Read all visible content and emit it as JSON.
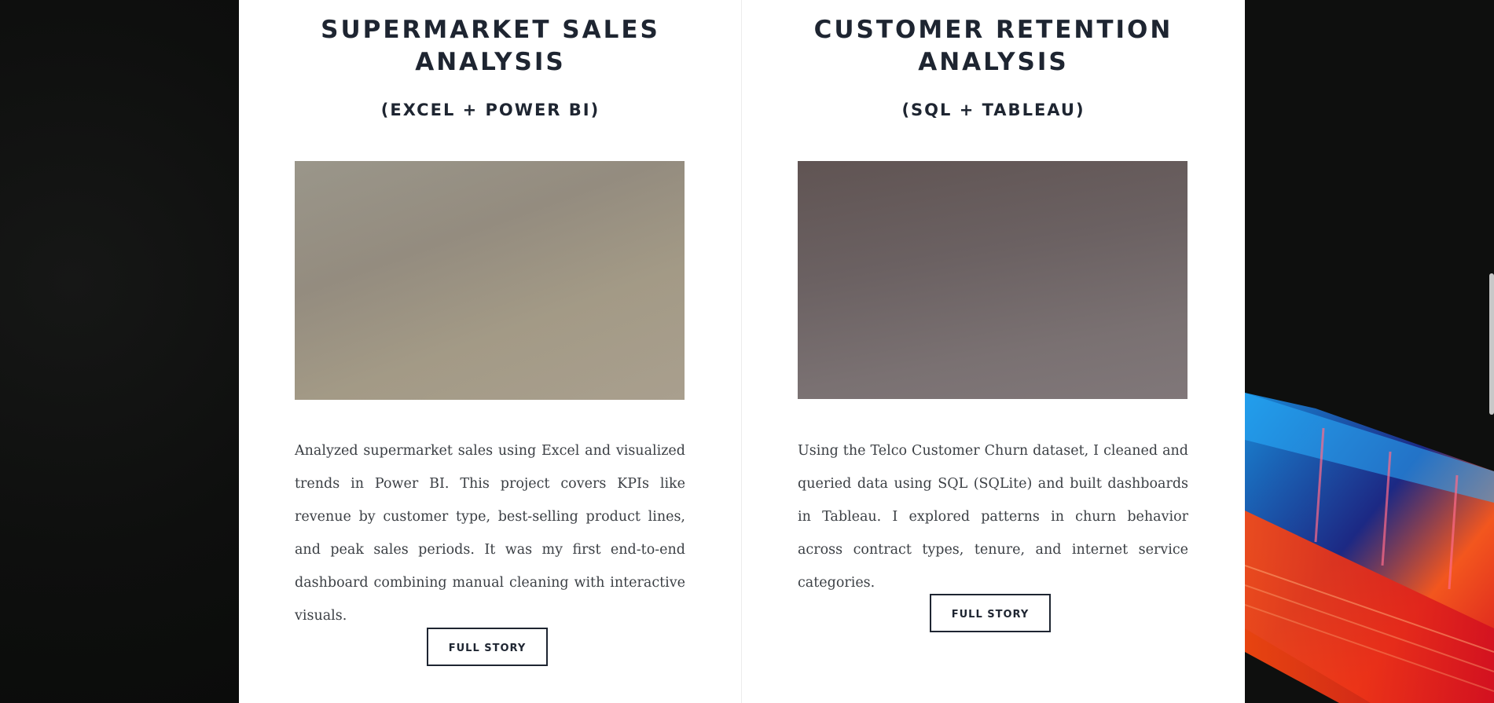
{
  "projects": [
    {
      "title_lines": [
        "SUPERMARKET SALES",
        "ANALYSIS"
      ],
      "subtitle": "(EXCEL + POWER BI)",
      "description": "Analyzed supermarket sales using Excel and visualized trends in Power BI. This project covers KPIs like revenue by customer type, best-selling product lines, and peak sales periods. It was my first end-to-end dashboard combining manual cleaning with interactive visuals.",
      "button_label": "FULL STORY"
    },
    {
      "title_lines": [
        "CUSTOMER RETENTION",
        "ANALYSIS"
      ],
      "subtitle": "(SQL + TABLEAU)",
      "description": "Using the Telco Customer Churn dataset, I cleaned and queried data using SQL (SQLite) and built dashboards in Tableau. I explored patterns in churn behavior across contract types, tenure, and internet service categories.",
      "button_label": "FULL STORY"
    }
  ],
  "colors": {
    "page_background": "#0f100f",
    "panel_background": "#ffffff",
    "heading_text": "#1e2531",
    "body_text": "#3b3f44"
  }
}
